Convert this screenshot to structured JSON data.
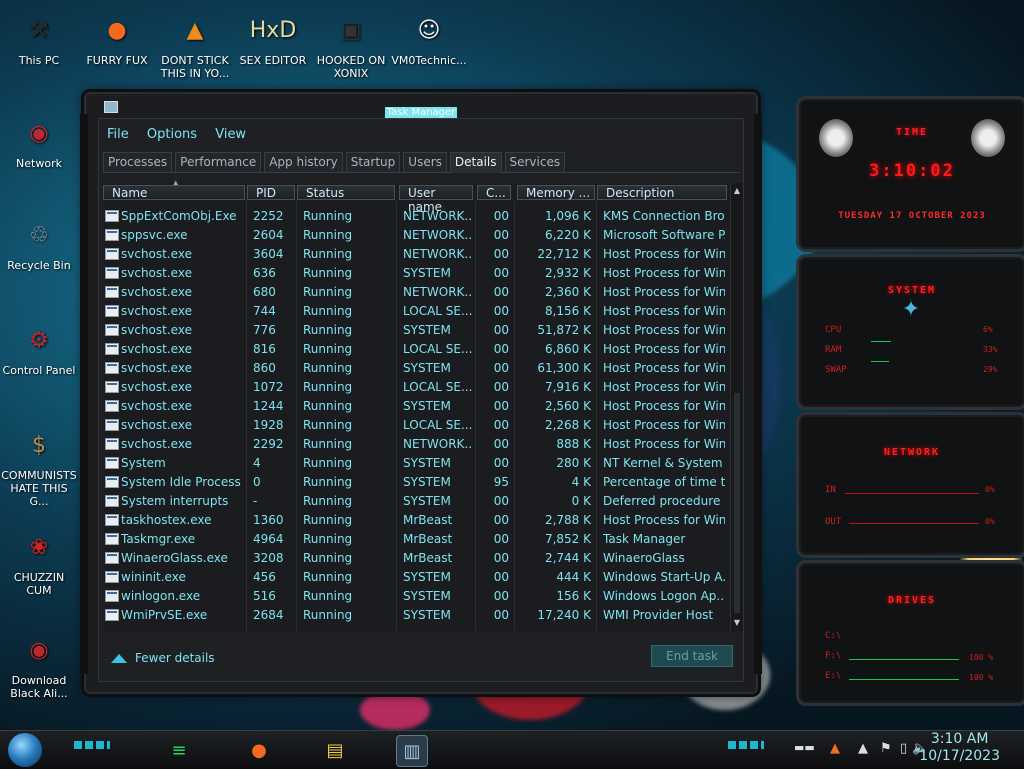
{
  "desktop": {
    "icons": [
      {
        "label": "This PC",
        "glyph": "⚒",
        "color": "#2a2a2a"
      },
      {
        "label": "FURRY FUX",
        "glyph": "●",
        "color": "#f36a1f"
      },
      {
        "label": "DONT STICK THIS IN YO...",
        "glyph": "▲",
        "color": "#f08a1c"
      },
      {
        "label": "SEX EDITOR",
        "glyph": "HxD",
        "color": "#e8d7a0"
      },
      {
        "label": "HOOKED ON XONIX",
        "glyph": "▣",
        "color": "#333"
      },
      {
        "label": "VM0Technic...",
        "glyph": "☺",
        "color": "#f1f1f1"
      },
      {
        "label": "Network",
        "glyph": "◉",
        "color": "#c0282f"
      },
      {
        "label": "Recycle Bin",
        "glyph": "♲",
        "color": "#aaa"
      },
      {
        "label": "Control Panel",
        "glyph": "⚙",
        "color": "#c0282f"
      },
      {
        "label": "COMMUNISTS HATE THIS G...",
        "glyph": "$",
        "color": "#b78b4a"
      },
      {
        "label": "CHUZZIN CUM",
        "glyph": "❀",
        "color": "#d52020"
      },
      {
        "label": "Download Black Ali...",
        "glyph": "◉",
        "color": "#c0282f"
      }
    ]
  },
  "taskmanager": {
    "title": "Task Manager",
    "menu": [
      "File",
      "Options",
      "View"
    ],
    "tabs": [
      "Processes",
      "Performance",
      "App history",
      "Startup",
      "Users",
      "Details",
      "Services"
    ],
    "active_tab": "Details",
    "columns": [
      "Name",
      "PID",
      "Status",
      "User name",
      "C...",
      "Memory ...",
      "Description"
    ],
    "rows": [
      [
        "SppExtComObj.Exe",
        "2252",
        "Running",
        "NETWORK...",
        "00",
        "1,096 K",
        "KMS Connection Bro..."
      ],
      [
        "sppsvc.exe",
        "2604",
        "Running",
        "NETWORK...",
        "00",
        "6,220 K",
        "Microsoft Software P..."
      ],
      [
        "svchost.exe",
        "3604",
        "Running",
        "NETWORK...",
        "00",
        "22,712 K",
        "Host Process for Win..."
      ],
      [
        "svchost.exe",
        "636",
        "Running",
        "SYSTEM",
        "00",
        "2,932 K",
        "Host Process for Win..."
      ],
      [
        "svchost.exe",
        "680",
        "Running",
        "NETWORK...",
        "00",
        "2,360 K",
        "Host Process for Win..."
      ],
      [
        "svchost.exe",
        "744",
        "Running",
        "LOCAL SE...",
        "00",
        "8,156 K",
        "Host Process for Win..."
      ],
      [
        "svchost.exe",
        "776",
        "Running",
        "SYSTEM",
        "00",
        "51,872 K",
        "Host Process for Win..."
      ],
      [
        "svchost.exe",
        "816",
        "Running",
        "LOCAL SE...",
        "00",
        "6,860 K",
        "Host Process for Win..."
      ],
      [
        "svchost.exe",
        "860",
        "Running",
        "SYSTEM",
        "00",
        "61,300 K",
        "Host Process for Win..."
      ],
      [
        "svchost.exe",
        "1072",
        "Running",
        "LOCAL SE...",
        "00",
        "7,916 K",
        "Host Process for Win..."
      ],
      [
        "svchost.exe",
        "1244",
        "Running",
        "SYSTEM",
        "00",
        "2,560 K",
        "Host Process for Win..."
      ],
      [
        "svchost.exe",
        "1928",
        "Running",
        "LOCAL SE...",
        "00",
        "2,268 K",
        "Host Process for Win..."
      ],
      [
        "svchost.exe",
        "2292",
        "Running",
        "NETWORK...",
        "00",
        "888 K",
        "Host Process for Win..."
      ],
      [
        "System",
        "4",
        "Running",
        "SYSTEM",
        "00",
        "280 K",
        "NT Kernel & System"
      ],
      [
        "System Idle Process",
        "0",
        "Running",
        "SYSTEM",
        "95",
        "4 K",
        "Percentage of time t..."
      ],
      [
        "System interrupts",
        "-",
        "Running",
        "SYSTEM",
        "00",
        "0 K",
        "Deferred procedure ..."
      ],
      [
        "taskhostex.exe",
        "1360",
        "Running",
        "MrBeast",
        "00",
        "2,788 K",
        "Host Process for Win..."
      ],
      [
        "Taskmgr.exe",
        "4964",
        "Running",
        "MrBeast",
        "00",
        "7,852 K",
        "Task Manager"
      ],
      [
        "WinaeroGlass.exe",
        "3208",
        "Running",
        "MrBeast",
        "00",
        "2,744 K",
        "WinaeroGlass"
      ],
      [
        "wininit.exe",
        "456",
        "Running",
        "SYSTEM",
        "00",
        "444 K",
        "Windows Start-Up A..."
      ],
      [
        "winlogon.exe",
        "516",
        "Running",
        "SYSTEM",
        "00",
        "156 K",
        "Windows Logon Ap..."
      ],
      [
        "WmiPrvSE.exe",
        "2684",
        "Running",
        "SYSTEM",
        "00",
        "17,240 K",
        "WMI Provider Host"
      ]
    ],
    "fewer_details": "Fewer details",
    "end_task": "End task"
  },
  "gadgets": {
    "time": {
      "title": "TIME",
      "clock": "3:10:02",
      "date": "TUESDAY 17 OCTOBER 2023"
    },
    "system": {
      "title": "SYSTEM",
      "cpu_label": "CPU",
      "cpu_val": "6%",
      "ram_label": "RAM",
      "ram_val": "33%",
      "swap_label": "SWAP",
      "swap_val": "29%"
    },
    "network": {
      "title": "NETWORK",
      "in_label": "IN",
      "in_val": "0%",
      "out_label": "OUT",
      "out_val": "0%"
    },
    "drives": {
      "title": "DRIVES",
      "c_label": "C:\\",
      "f_label": "F:\\",
      "f_val": "100 %",
      "e_label": "E:\\",
      "e_val": "100 %"
    }
  },
  "taskbar": {
    "time": "3:10 AM",
    "date": "10/17/2023",
    "apps": [
      {
        "name": "spotify-app",
        "glyph": "≡",
        "color": "#1ed760"
      },
      {
        "name": "firefox-app",
        "glyph": "●",
        "color": "#f36a1f"
      },
      {
        "name": "file-explorer-app",
        "glyph": "▤",
        "color": "#f2c84b"
      },
      {
        "name": "task-manager-app",
        "glyph": "▥",
        "color": "#9cc7e6"
      }
    ]
  },
  "colors": {
    "accent_text": "#7ee3f0",
    "gadget_red": "#ff1a1a",
    "window_bg": "#1b1d20"
  }
}
